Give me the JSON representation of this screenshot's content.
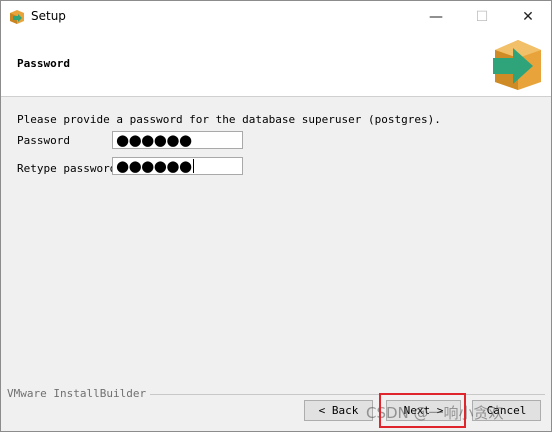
{
  "window": {
    "title": "Setup",
    "app_icon": "installbuilder-box-icon"
  },
  "controls": {
    "minimize": "—",
    "maximize": "☐",
    "close": "✕"
  },
  "header": {
    "title": "Password",
    "logo_icon": "box-arrow-icon"
  },
  "content": {
    "intro": "Please provide a password for the database superuser (postgres).",
    "password_label": "Password",
    "password_value": "●●●●●●",
    "retype_label": "Retype password",
    "retype_value": "●●●●●●"
  },
  "footer": {
    "brand": "VMware InstallBuilder",
    "back_label": "< Back",
    "next_label": "Next >",
    "cancel_label": "Cancel"
  },
  "watermark": "CSDN @一响小贪欢",
  "colors": {
    "highlight": "#e0242c",
    "logo_orange": "#e8a43a",
    "logo_green": "#2fa37a"
  }
}
